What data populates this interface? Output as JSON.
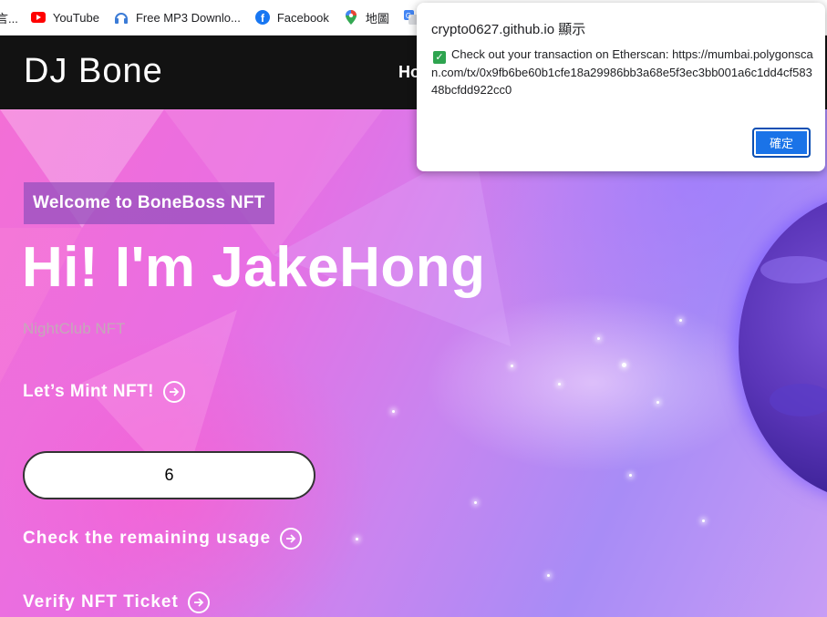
{
  "bookmarks": {
    "items": [
      {
        "label": "言...",
        "icon": "bookmark-icon"
      },
      {
        "label": "YouTube",
        "icon": "youtube-icon"
      },
      {
        "label": "Free MP3 Downlo...",
        "icon": "headphones-icon"
      },
      {
        "label": "Facebook",
        "icon": "facebook-icon"
      },
      {
        "label": "地圖",
        "icon": "maps-pin-icon"
      },
      {
        "label": "",
        "icon": "translate-icon"
      }
    ]
  },
  "nav": {
    "brand": "DJ Bone",
    "link": "Ho"
  },
  "hero": {
    "welcome": "Welcome to BoneBoss NFT",
    "headline": "Hi! I'm JakeHong",
    "subtitle": "NightClub NFT",
    "mint_cta": "Let’s Mint NFT!",
    "mint_input_value": "6",
    "check_cta": "Check the remaining usage",
    "verify_cta": "Verify NFT Ticket"
  },
  "dialog": {
    "title": "crypto0627.github.io 顯示",
    "message": "Check out your transaction on Etherscan: https://mumbai.polygonscan.com/tx/0x9fb6be60b1cfe18a29986bb3a68e5f3ec3bb001a6c1dd4cf58348bcfdd922cc0",
    "ok_label": "確定"
  },
  "colors": {
    "nav_bg": "#121212",
    "dialog_button": "#1a73e8",
    "check_green": "#2ea44f",
    "planet": "#5a35b8"
  }
}
